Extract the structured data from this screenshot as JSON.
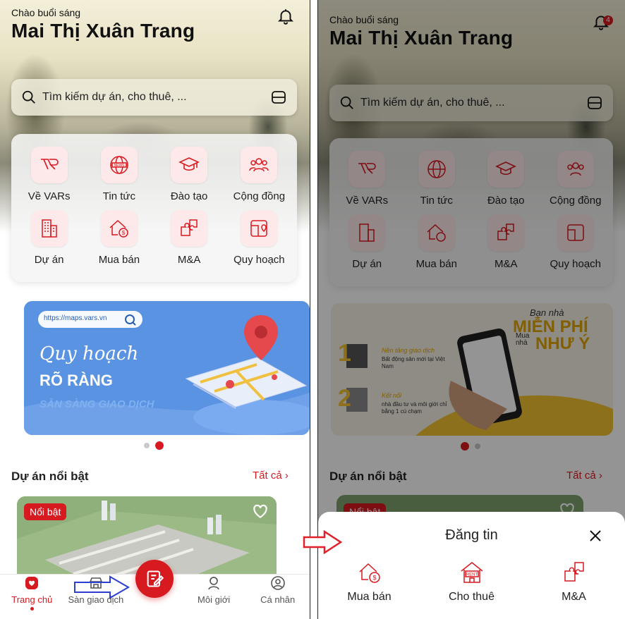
{
  "colors": {
    "brand_red": "#d71920",
    "pink_bg": "#fde9ea",
    "banner_blue": "#5b93e3"
  },
  "left_screen": {
    "greeting": "Chào buổi sáng",
    "user_name": "Mai Thị Xuân Trang",
    "search": {
      "placeholder": "Tìm kiếm dự án, cho thuê, ..."
    },
    "menu": [
      {
        "label": "Về VARs",
        "icon": "vars-logo-icon"
      },
      {
        "label": "Tin tức",
        "icon": "news-globe-icon"
      },
      {
        "label": "Đào tạo",
        "icon": "graduation-cap-icon"
      },
      {
        "label": "Cộng đồng",
        "icon": "community-icon"
      },
      {
        "label": "Dự án",
        "icon": "building-icon"
      },
      {
        "label": "Mua bán",
        "icon": "house-money-icon"
      },
      {
        "label": "M&A",
        "icon": "puzzle-icon"
      },
      {
        "label": "Quy hoạch",
        "icon": "map-pin-icon"
      }
    ],
    "banner": {
      "url": "https://maps.vars.vn",
      "script_line": "Quy hoạch",
      "headline": "RÕ RÀNG",
      "tagline": "SẴN SÀNG GIAO DỊCH"
    },
    "carousel": {
      "count": 2,
      "active_index": 1
    },
    "featured": {
      "title": "Dự án nổi bật",
      "see_all": "Tất cả",
      "tag": "Nổi bật"
    },
    "tabbar": [
      {
        "label": "Trang chủ",
        "icon": "home-heart-icon",
        "active": true
      },
      {
        "label": "Sàn giao dịch",
        "icon": "marketplace-icon",
        "active": false
      },
      {
        "label": "Môi giới",
        "icon": "agent-icon",
        "active": false
      },
      {
        "label": "Cá nhân",
        "icon": "profile-icon",
        "active": false
      }
    ]
  },
  "right_screen": {
    "greeting": "Chào buổi sáng",
    "user_name": "Mai Thị Xuân Trang",
    "notification_count": "4",
    "search": {
      "placeholder": "Tìm kiếm dự án, cho thuê, ..."
    },
    "menu": [
      {
        "label": "Về VARs"
      },
      {
        "label": "Tin tức"
      },
      {
        "label": "Đào tạo"
      },
      {
        "label": "Cộng đồng"
      },
      {
        "label": "Dự án"
      },
      {
        "label": "Mua bán"
      },
      {
        "label": "M&A"
      },
      {
        "label": "Quy hoạch"
      }
    ],
    "banner": {
      "top_line": "Bạn nhà",
      "big_line1": "MIỄN PHÍ",
      "small_line": "Mua nhà",
      "big_line2": "NHƯ Ý",
      "item1_num": "1",
      "item1_title": "Nền tảng giao dịch",
      "item1_text": "Bất động sản mới tại Việt Nam",
      "item2_num": "2",
      "item2_title": "Kết nối",
      "item2_text": "nhà đầu tư và môi giới chỉ bằng 1 cú chạm"
    },
    "carousel": {
      "count": 2,
      "active_index": 0
    },
    "featured": {
      "title": "Dự án nổi bật",
      "see_all": "Tất cả",
      "tag": "Nổi bật"
    },
    "sheet": {
      "title": "Đăng tin",
      "options": [
        {
          "label": "Mua bán",
          "icon": "house-money-icon"
        },
        {
          "label": "Cho thuê",
          "icon": "rent-house-icon",
          "icon_text": "RENT"
        },
        {
          "label": "M&A",
          "icon": "puzzle-icon"
        }
      ]
    }
  }
}
